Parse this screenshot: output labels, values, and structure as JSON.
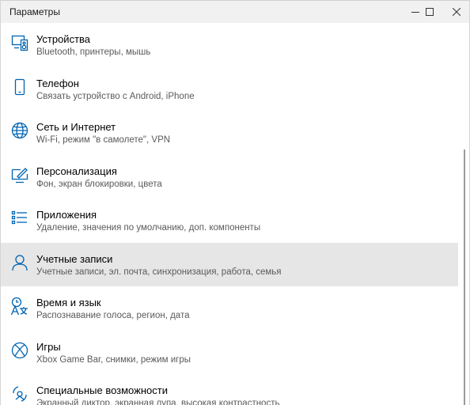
{
  "window": {
    "title": "Параметры"
  },
  "items": [
    {
      "label": "Устройства",
      "desc": "Bluetooth, принтеры, мышь",
      "icon": "devices-icon"
    },
    {
      "label": "Телефон",
      "desc": "Связать устройство с Android, iPhone",
      "icon": "phone-icon"
    },
    {
      "label": "Сеть и Интернет",
      "desc": "Wi-Fi, режим \"в самолете\", VPN",
      "icon": "globe-icon"
    },
    {
      "label": "Персонализация",
      "desc": "Фон, экран блокировки, цвета",
      "icon": "personalization-icon"
    },
    {
      "label": "Приложения",
      "desc": "Удаление, значения по умолчанию, доп. компоненты",
      "icon": "apps-icon"
    },
    {
      "label": "Учетные записи",
      "desc": "Учетные записи, эл. почта, синхронизация, работа, семья",
      "icon": "person-icon",
      "selected": true
    },
    {
      "label": "Время и язык",
      "desc": "Распознавание голоса, регион, дата",
      "icon": "time-language-icon"
    },
    {
      "label": "Игры",
      "desc": "Xbox Game Bar, снимки, режим игры",
      "icon": "xbox-icon"
    },
    {
      "label": "Специальные возможности",
      "desc": "Экранный диктор, экранная лупа, высокая контрастность",
      "icon": "ease-of-access-icon"
    }
  ],
  "colors": {
    "accent": "#0063b1",
    "selected_bg": "#e6e6e6",
    "desc_text": "#5a5a5a"
  }
}
